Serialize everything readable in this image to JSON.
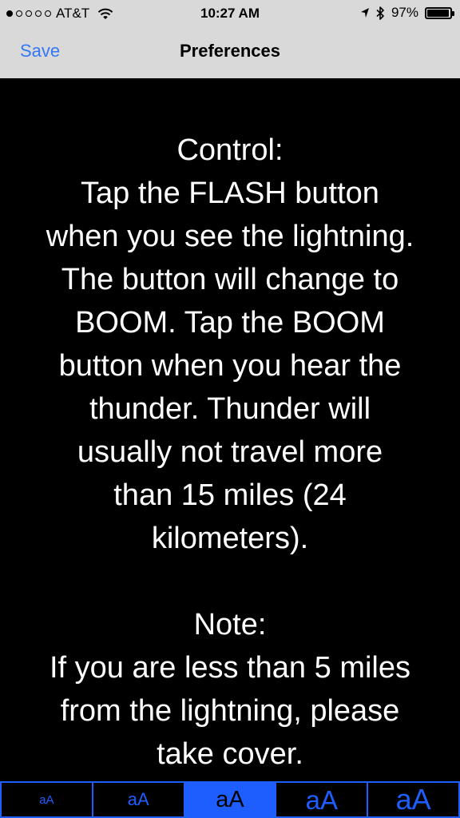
{
  "status_bar": {
    "signal_dots": [
      true,
      false,
      false,
      false,
      false
    ],
    "carrier": "AT&T",
    "time": "10:27 AM",
    "battery_percent": "97%",
    "battery_level": 0.97
  },
  "nav": {
    "save_label": "Save",
    "title": "Preferences",
    "accent_color": "#3478f6"
  },
  "content": {
    "control_text": "Control:\nTap the FLASH button\nwhen you see the lightning.\nThe button will change to\nBOOM. Tap the BOOM\nbutton when you hear the\nthunder. Thunder will\nusually not travel more\nthan 15 miles (24\nkilometers).",
    "note_text": "Note:\nIf you are less than 5 miles\nfrom the lightning, please\ntake cover."
  },
  "font_size_selector": {
    "accent_color": "#1e5eff",
    "selected_index": 2,
    "options": [
      {
        "label": "aA"
      },
      {
        "label": "aA"
      },
      {
        "label": "aA"
      },
      {
        "label": "aA"
      },
      {
        "label": "aA"
      }
    ]
  }
}
